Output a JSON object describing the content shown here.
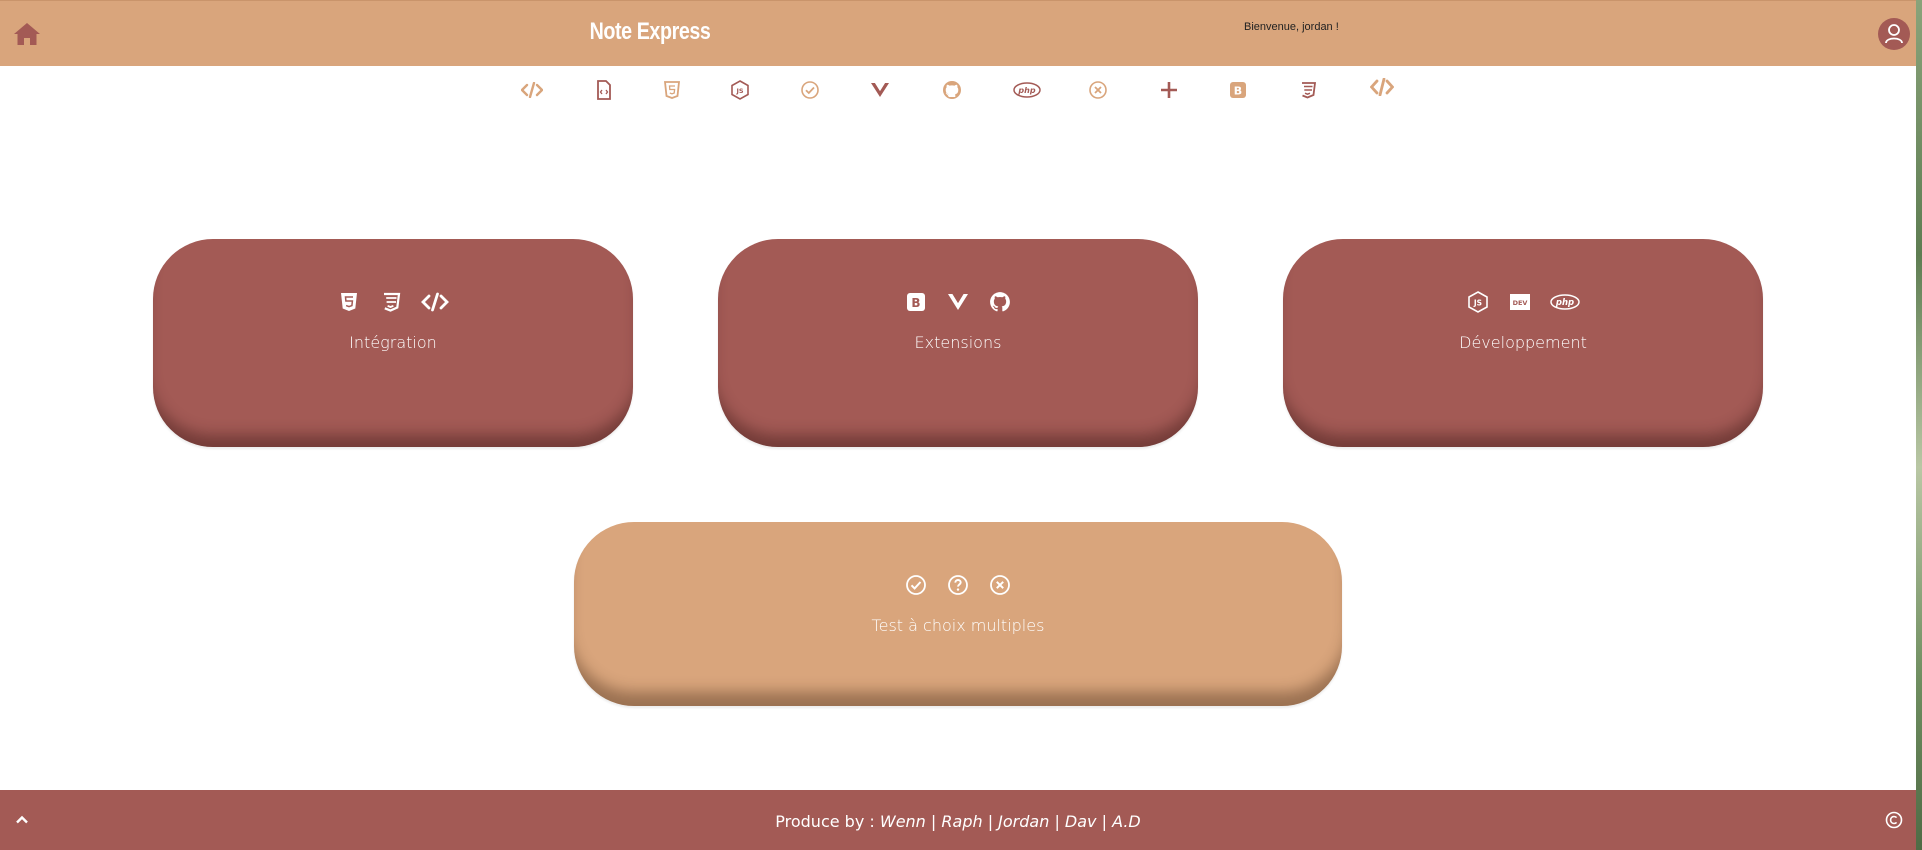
{
  "header": {
    "title": "Note Express",
    "welcome": "Bienvenue, jordan !",
    "home_icon": "home-icon",
    "user_icon": "user-icon"
  },
  "icon_bar": [
    {
      "name": "code-icon",
      "color": "#d9a57c"
    },
    {
      "name": "file-code-icon",
      "color": "#a35a55"
    },
    {
      "name": "html5-icon",
      "color": "#d9a57c"
    },
    {
      "name": "nodejs-icon",
      "color": "#a35a55"
    },
    {
      "name": "check-circle-icon",
      "color": "#d9a57c"
    },
    {
      "name": "vuejs-icon",
      "color": "#a35a55"
    },
    {
      "name": "github-icon",
      "color": "#d9a57c"
    },
    {
      "name": "php-icon",
      "color": "#a35a55"
    },
    {
      "name": "x-circle-icon",
      "color": "#d9a57c"
    },
    {
      "name": "plus-icon",
      "color": "#a35a55"
    },
    {
      "name": "bootstrap-icon",
      "color": "#d9a57c"
    },
    {
      "name": "css3-icon",
      "color": "#a35a55"
    },
    {
      "name": "code-icon",
      "color": "#d9a57c"
    }
  ],
  "cards": {
    "integration": {
      "label": "Intégration",
      "icons": [
        "html5-icon",
        "css3-icon",
        "code-icon"
      ]
    },
    "extensions": {
      "label": "Extensions",
      "icons": [
        "bootstrap-icon",
        "vuejs-icon",
        "github-icon"
      ]
    },
    "development": {
      "label": "Développement",
      "icons": [
        "nodejs-icon",
        "dev-icon",
        "php-icon"
      ]
    },
    "qcm": {
      "label": "Test à choix multiples",
      "icons": [
        "check-circle-icon",
        "question-circle-icon",
        "x-circle-icon"
      ]
    }
  },
  "footer": {
    "prefix": "Produce by :",
    "authors": [
      "Wenn",
      "Raph",
      "Jordan",
      "Dav",
      "A.D"
    ],
    "separator": " | "
  },
  "colors": {
    "tan": "#d9a57c",
    "brick": "#a35a55",
    "white": "#ffffff"
  }
}
